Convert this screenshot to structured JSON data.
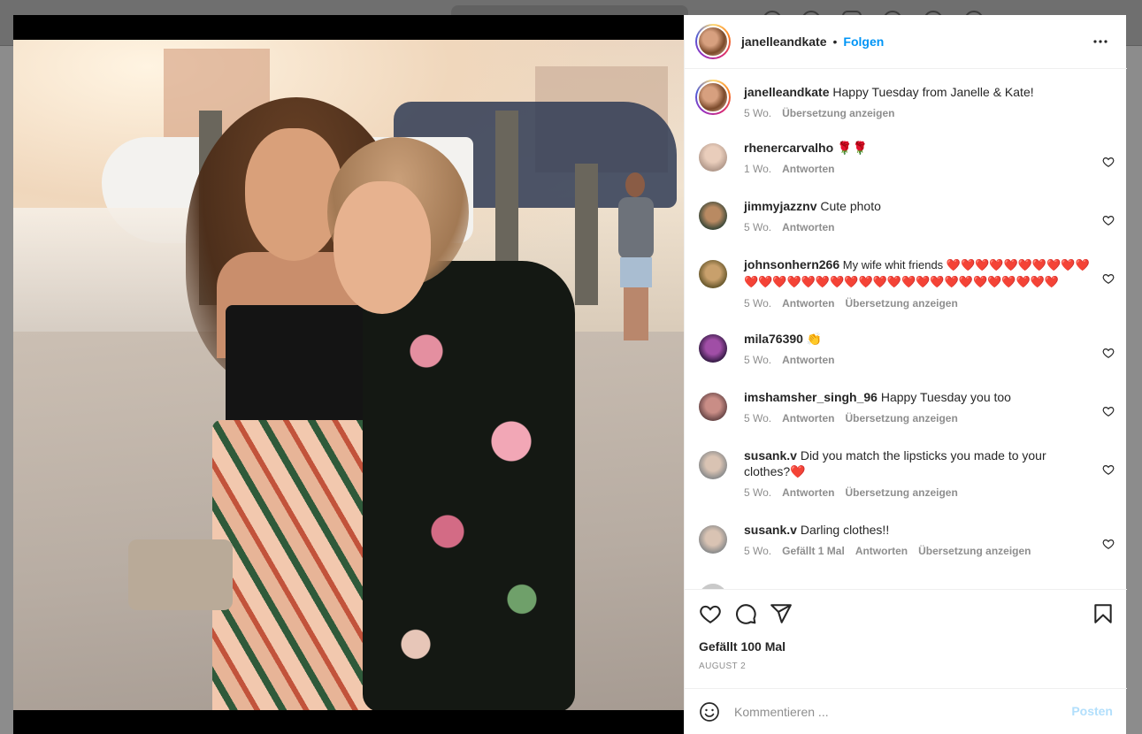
{
  "background_nav": {},
  "post": {
    "username": "janelleandkate",
    "dot": "•",
    "follow_label": "Folgen",
    "more_label": "•••",
    "caption": {
      "username": "janelleandkate",
      "text": "Happy Tuesday from Janelle & Kate!",
      "age": "5 Wo.",
      "translate": "Übersetzung anzeigen"
    }
  },
  "comments": [
    {
      "username": "rhenercarvalho",
      "text": " 🌹🌹",
      "age": "1 Wo.",
      "reply": "Antworten",
      "translate": "",
      "likes": ""
    },
    {
      "username": "jimmyjazznv",
      "text": " Cute photo",
      "age": "5 Wo.",
      "reply": "Antworten",
      "translate": "",
      "likes": ""
    },
    {
      "username": "johnsonhern266",
      "text": " My wife whit friends ❤️❤️❤️❤️❤️❤️❤️❤️❤️❤️❤️❤️❤️❤️❤️❤️❤️❤️❤️❤️❤️❤️❤️❤️❤️❤️❤️❤️❤️❤️❤️❤️",
      "age": "5 Wo.",
      "reply": "Antworten",
      "translate": "Übersetzung anzeigen",
      "likes": ""
    },
    {
      "username": "mila76390",
      "text": " 👏",
      "age": "5 Wo.",
      "reply": "Antworten",
      "translate": "",
      "likes": ""
    },
    {
      "username": "imshamsher_singh_96",
      "text": " Happy Tuesday you too",
      "age": "5 Wo.",
      "reply": "Antworten",
      "translate": "Übersetzung anzeigen",
      "likes": ""
    },
    {
      "username": "susank.v",
      "text": " Did you match the lipsticks you made to your clothes?❤️",
      "age": "5 Wo.",
      "reply": "Antworten",
      "translate": "Übersetzung anzeigen",
      "likes": ""
    },
    {
      "username": "susank.v",
      "text": " Darling clothes!!",
      "age": "5 Wo.",
      "reply": "Antworten",
      "translate": "Übersetzung anzeigen",
      "likes": "Gefällt 1 Mal"
    }
  ],
  "actions": {
    "likes": "Gefällt 100 Mal",
    "date": "AUGUST 2"
  },
  "add_comment": {
    "placeholder": "Kommentieren ...",
    "post_label": "Posten"
  },
  "colors": {
    "follow": "#0095f6",
    "post_disabled": "#b2dffc",
    "secondary_text": "#8e8e8e"
  }
}
